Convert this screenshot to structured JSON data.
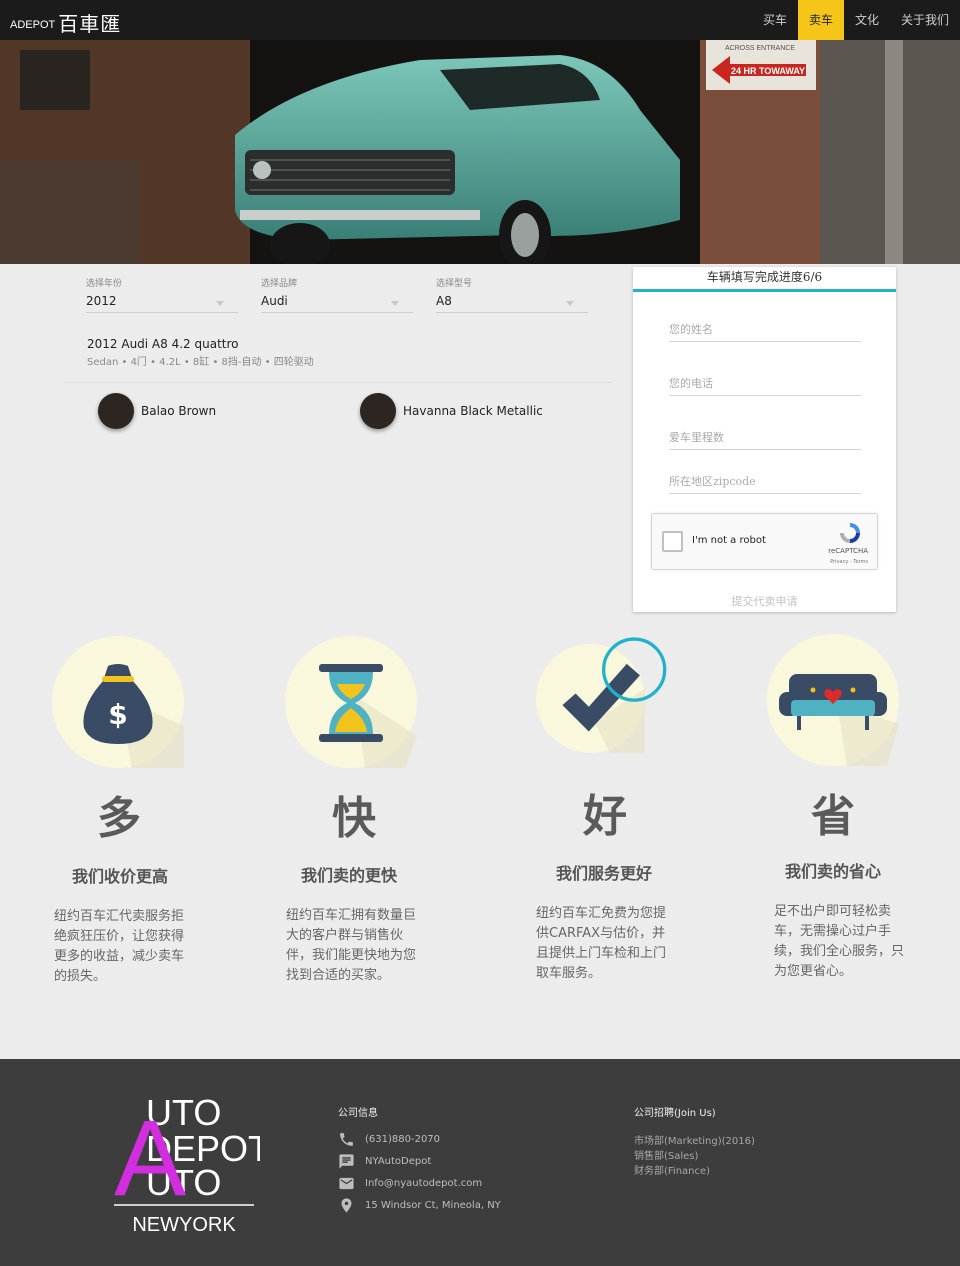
{
  "nav": {
    "logo_small": "ADEPOT",
    "logo_text": "百車匯",
    "items": [
      {
        "label": "买车",
        "active": false
      },
      {
        "label": "卖车",
        "active": true
      },
      {
        "label": "文化",
        "active": false
      },
      {
        "label": "关于我们",
        "active": false
      }
    ]
  },
  "hero": {
    "sign_top": "ACROSS ENTRANCE",
    "sign_main": "24 HR TOWAWAY"
  },
  "selects": [
    {
      "label": "选择年份",
      "value": "2012"
    },
    {
      "label": "选择品牌",
      "value": "Audi"
    },
    {
      "label": "选择型号",
      "value": "A8"
    }
  ],
  "car": {
    "title": "2012 Audi A8 4.2 quattro",
    "spec": "Sedan • 4门 • 4.2L • 8缸 • 8挡-自动 • 四轮驱动"
  },
  "colors": [
    {
      "name": "Balao Brown",
      "hex": "#2c2521"
    },
    {
      "name": "Havanna Black Metallic",
      "hex": "#2c2521"
    }
  ],
  "form": {
    "title": "车辆填写完成进度6/6",
    "fields": [
      {
        "placeholder": "您的姓名"
      },
      {
        "placeholder": "您的电话"
      },
      {
        "placeholder": "爱车里程数"
      },
      {
        "placeholder": "所在地区zipcode"
      }
    ],
    "captcha": {
      "label": "I'm not a robot",
      "brand": "reCAPTCHA",
      "links": "Privacy - Terms"
    },
    "submit": "提交代卖申请"
  },
  "features": [
    {
      "icon": "money-bag-icon",
      "char": "多",
      "heading": "我们收价更高",
      "text": "纽约百车汇代卖服务拒绝疯狂压价，让您获得更多的收益，减少卖车的损失。"
    },
    {
      "icon": "hourglass-icon",
      "char": "快",
      "heading": "我们卖的更快",
      "text": "纽约百车汇拥有数量巨大的客户群与销售伙伴，我们能更快地为您找到合适的买家。"
    },
    {
      "icon": "checkmark-icon",
      "char": "好",
      "heading": "我们服务更好",
      "text": "纽约百车汇免费为您提供CARFAX与估价，并且提供上门车检和上门取车服务。"
    },
    {
      "icon": "sofa-icon",
      "char": "省",
      "heading": "我们卖的省心",
      "text": "足不出户即可轻松卖车，无需操心过户手续，我们全心服务，只为您更省心。"
    }
  ],
  "footer": {
    "logo": {
      "line1": "UTO",
      "line2": "DEPOT",
      "line3": "UTO",
      "big_a": "A",
      "city": "NEWYORK"
    },
    "info_title": "公司信息",
    "info": [
      {
        "icon": "phone-icon",
        "text": "(631)880-2070"
      },
      {
        "icon": "message-icon",
        "text": "NYAutoDepot"
      },
      {
        "icon": "email-icon",
        "text": "Info@nyautodepot.com"
      },
      {
        "icon": "location-icon",
        "text": "15 Windsor Ct, Mineola, NY"
      }
    ],
    "jobs_title": "公司招聘(Join Us)",
    "jobs": [
      "市场部(Marketing)(2016)",
      "销售部(Sales)",
      "财务部(Finance)"
    ]
  },
  "colors_theme": {
    "accent": "#1fb2c9",
    "nav_active": "#f5c518",
    "footer_bg": "#3d3d3d"
  }
}
